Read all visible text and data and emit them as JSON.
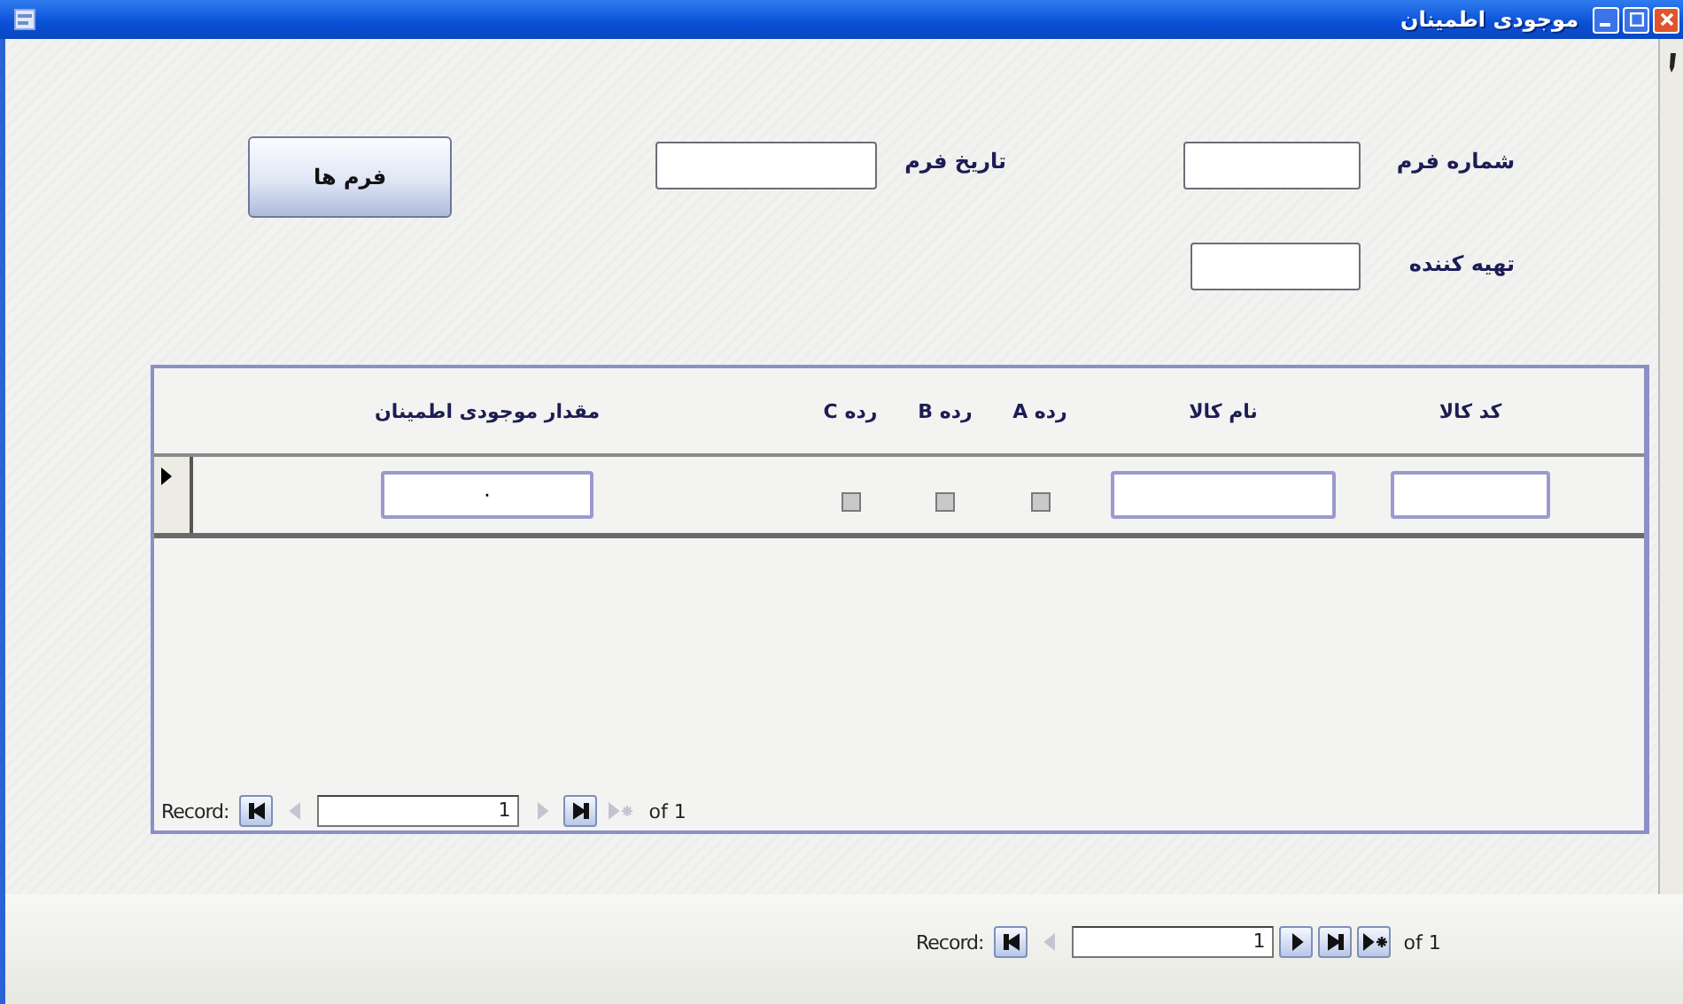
{
  "window": {
    "title": "موجودی اطمینان"
  },
  "form": {
    "fields": [
      {
        "label": "شماره فرم"
      },
      {
        "label": "تاریخ فرم"
      },
      {
        "label": "تهیه کننده"
      }
    ],
    "button": "فرم ها"
  },
  "subform": {
    "columns": [
      "کد کالا",
      "نام کالا",
      "رده A",
      "رده B",
      "رده C",
      "مقدار موجودی اطمینان"
    ],
    "rows": [
      {
        "current": true,
        "cells": [
          {
            "kind": "field"
          },
          {
            "kind": "field"
          },
          {
            "kind": "checkbox",
            "checked": false
          },
          {
            "kind": "checkbox",
            "checked": false
          },
          {
            "kind": "checkbox",
            "checked": false
          },
          {
            "kind": "field",
            "value": "۰"
          }
        ]
      }
    ],
    "navigation": {
      "label": "Record:",
      "value": "1",
      "total": "of 1",
      "buttons": [
        {
          "kind": "first",
          "disabled": false
        },
        {
          "kind": "prev",
          "disabled": true
        },
        {
          "kind": "next",
          "disabled": true
        },
        {
          "kind": "last",
          "disabled": false
        },
        {
          "kind": "new",
          "disabled": true
        }
      ]
    }
  },
  "navigation": {
    "label": "Record:",
    "value": "1",
    "total": "of 1",
    "buttons": [
      {
        "kind": "first",
        "disabled": false
      },
      {
        "kind": "prev",
        "disabled": true
      },
      {
        "kind": "next",
        "disabled": false
      },
      {
        "kind": "last",
        "disabled": false
      },
      {
        "kind": "new",
        "disabled": false
      }
    ]
  }
}
